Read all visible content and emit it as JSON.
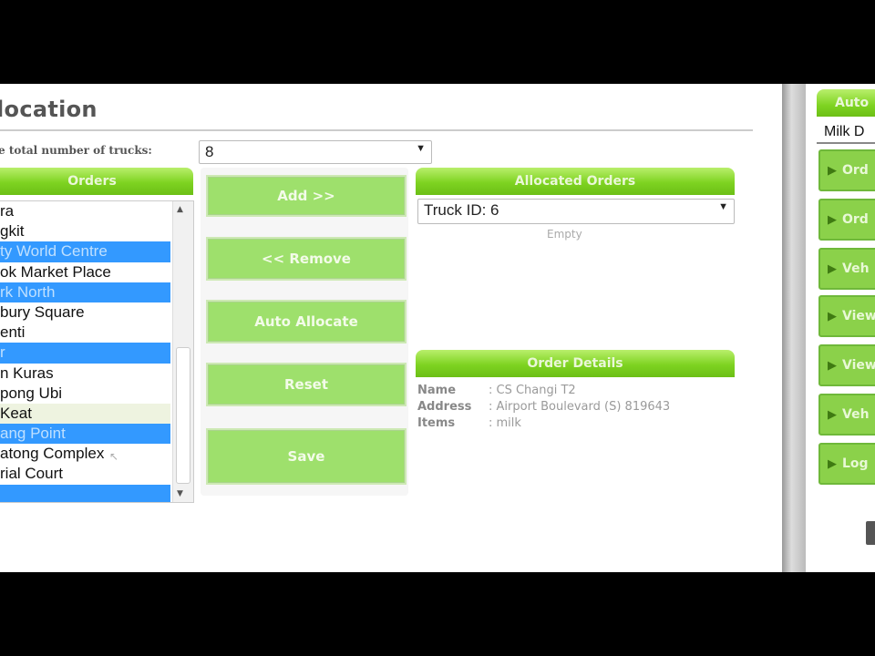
{
  "page": {
    "title": "location"
  },
  "trucks": {
    "label": "e total number of trucks:",
    "value": "8"
  },
  "orders": {
    "header": "Orders",
    "items": [
      {
        "label": "ra",
        "state": "normal"
      },
      {
        "label": "gkit",
        "state": "normal"
      },
      {
        "label": "ty World Centre",
        "state": "selected"
      },
      {
        "label": "ok Market Place",
        "state": "normal"
      },
      {
        "label": "rk North",
        "state": "selected"
      },
      {
        "label": "bury Square",
        "state": "normal"
      },
      {
        "label": "enti",
        "state": "normal"
      },
      {
        "label": "r",
        "state": "selected"
      },
      {
        "label": "n Kuras",
        "state": "normal"
      },
      {
        "label": "pong Ubi",
        "state": "normal"
      },
      {
        "label": "Keat",
        "state": "highlight"
      },
      {
        "label": "ang Point",
        "state": "selected"
      },
      {
        "label": "atong Complex",
        "state": "normal"
      },
      {
        "label": "rial Court",
        "state": "normal"
      },
      {
        "label": "",
        "state": "selected"
      }
    ]
  },
  "buttons": {
    "add": "Add >>",
    "remove": "<< Remove",
    "auto_allocate": "Auto Allocate",
    "reset": "Reset",
    "save": "Save"
  },
  "allocated": {
    "header": "Allocated Orders",
    "truck_select": "Truck ID: 6",
    "empty_text": "Empty"
  },
  "details": {
    "header": "Order Details",
    "name_label": "Name",
    "name_value": ": CS Changi T2",
    "address_label": "Address",
    "address_value": ": Airport Boulevard (S) 819643",
    "items_label": "Items",
    "items_value": ": milk"
  },
  "sidebar": {
    "header": "Auto",
    "subtitle": "Milk D",
    "items": [
      "Ord",
      "Ord",
      "Veh",
      "View",
      "View",
      "Veh",
      "Log"
    ]
  },
  "colors": {
    "accent_green": "#7ed321",
    "selection_blue": "#3399ff"
  },
  "icons": {
    "sidebar_item": "play-triangle-icon",
    "trash": "trash-icon"
  }
}
